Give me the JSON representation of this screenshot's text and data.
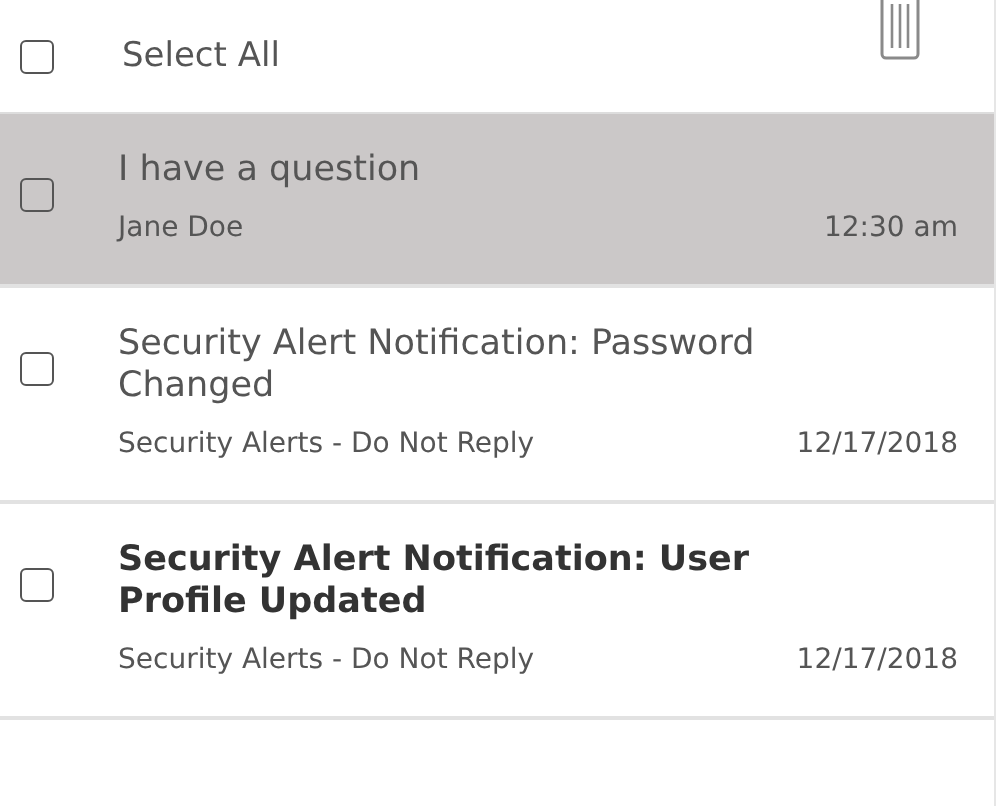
{
  "header": {
    "select_all": {
      "label": "Select All",
      "checked": false
    }
  },
  "messages": [
    {
      "subject": "I have a question",
      "sender": "Jane Doe",
      "time": "12:30 am",
      "selected": true,
      "unread": false,
      "checked": false
    },
    {
      "subject": "Security Alert Notification: Password Changed",
      "sender": "Security Alerts - Do Not Reply",
      "time": "12/17/2018",
      "selected": false,
      "unread": false,
      "checked": false
    },
    {
      "subject": "Security Alert Notification: User Profile Updated",
      "sender": "Security Alerts - Do Not Reply",
      "time": "12/17/2018",
      "selected": false,
      "unread": true,
      "checked": false
    }
  ]
}
